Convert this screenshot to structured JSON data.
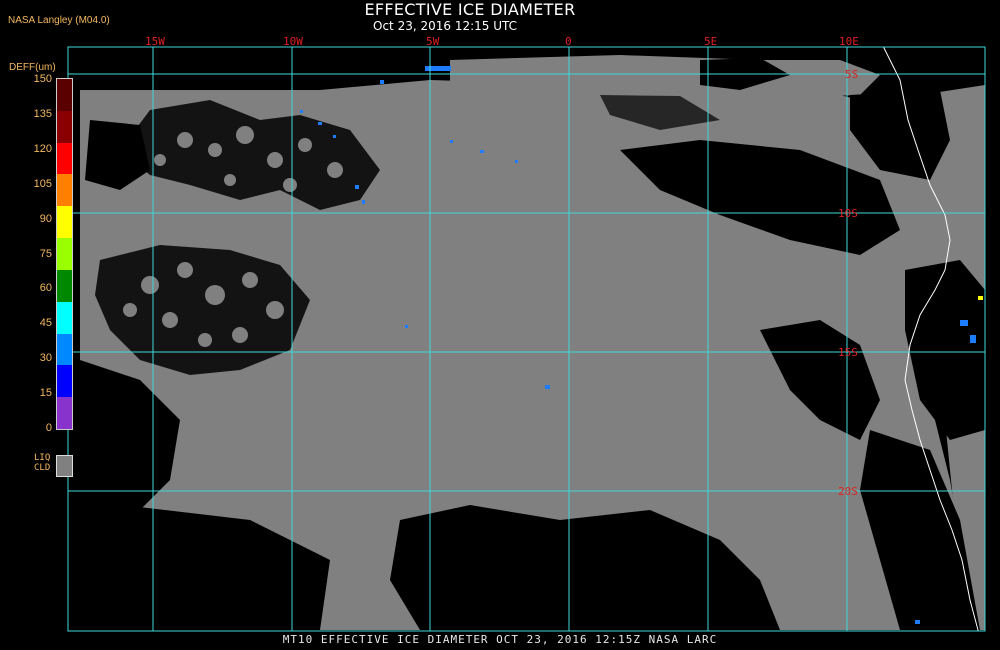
{
  "header": {
    "credit": "NASA Langley (M04.0)",
    "title": "EFFECTIVE ICE DIAMETER",
    "subtitle": "Oct 23, 2016 12:15 UTC"
  },
  "map": {
    "lon_labels": [
      "15W",
      "10W",
      "5W",
      "0",
      "5E",
      "10E"
    ],
    "lat_labels": [
      "5S",
      "10S",
      "15S",
      "20S"
    ],
    "grid_color": "#40d8d8",
    "cloud_color": "#808080",
    "clear_color": "#000000",
    "coastline_color": "#ffffff"
  },
  "colorbar": {
    "title": "DEFF(um)",
    "ticks": [
      "150",
      "135",
      "120",
      "105",
      "90",
      "75",
      "60",
      "45",
      "30",
      "15",
      "0"
    ],
    "colors": [
      "#5a0000",
      "#8a0000",
      "#ff0000",
      "#ff7f00",
      "#ffff00",
      "#9aff00",
      "#008800",
      "#00ffff",
      "#0088ff",
      "#0000ff",
      "#8833cc"
    ],
    "liq_label": "LIQ\nCLD"
  },
  "footer": {
    "text": "MT10  EFFECTIVE ICE DIAMETER   OCT 23, 2016 12:15Z   NASA LARC"
  }
}
